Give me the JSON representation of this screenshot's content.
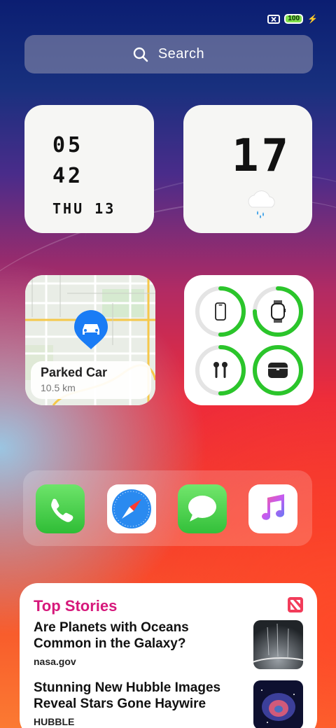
{
  "status": {
    "sim_icon": "no-sim-icon",
    "battery_level": "100",
    "charging_icon": "bolt-icon"
  },
  "search": {
    "label": "Search",
    "icon": "search-icon"
  },
  "clock_widget": {
    "hour": "05",
    "minute": "42",
    "date": "THU 13"
  },
  "weather_widget": {
    "temperature": "17",
    "icon": "rain-cloud-icon"
  },
  "map_widget": {
    "title": "Parked Car",
    "distance": "10.5 km",
    "icon": "car-pin-icon",
    "accent": "#1a7cf5"
  },
  "battery_widget": {
    "accent": "#2bc52b",
    "devices": [
      {
        "name": "iphone",
        "icon": "iphone-icon",
        "level": 0.5
      },
      {
        "name": "watch",
        "icon": "watch-icon",
        "level": 0.75
      },
      {
        "name": "airpods",
        "icon": "airpods-icon",
        "level": 0.5
      },
      {
        "name": "airpods-case",
        "icon": "airpods-case-icon",
        "level": 1.0
      }
    ]
  },
  "dock": {
    "apps": [
      {
        "name": "Phone",
        "icon": "phone-icon"
      },
      {
        "name": "Safari",
        "icon": "safari-icon"
      },
      {
        "name": "Messages",
        "icon": "messages-icon"
      },
      {
        "name": "Music",
        "icon": "music-icon"
      }
    ]
  },
  "news_widget": {
    "heading": "Top Stories",
    "heading_color": "#d6187b",
    "logo_icon": "news-icon",
    "stories": [
      {
        "title_line1": "Are Planets with Oceans",
        "title_line2": "Common in the Galaxy?",
        "source": "nasa.gov"
      },
      {
        "title_line1": "Stunning New Hubble Images",
        "title_line2": "Reveal Stars Gone Haywire",
        "source": "HUBBLE"
      }
    ]
  }
}
